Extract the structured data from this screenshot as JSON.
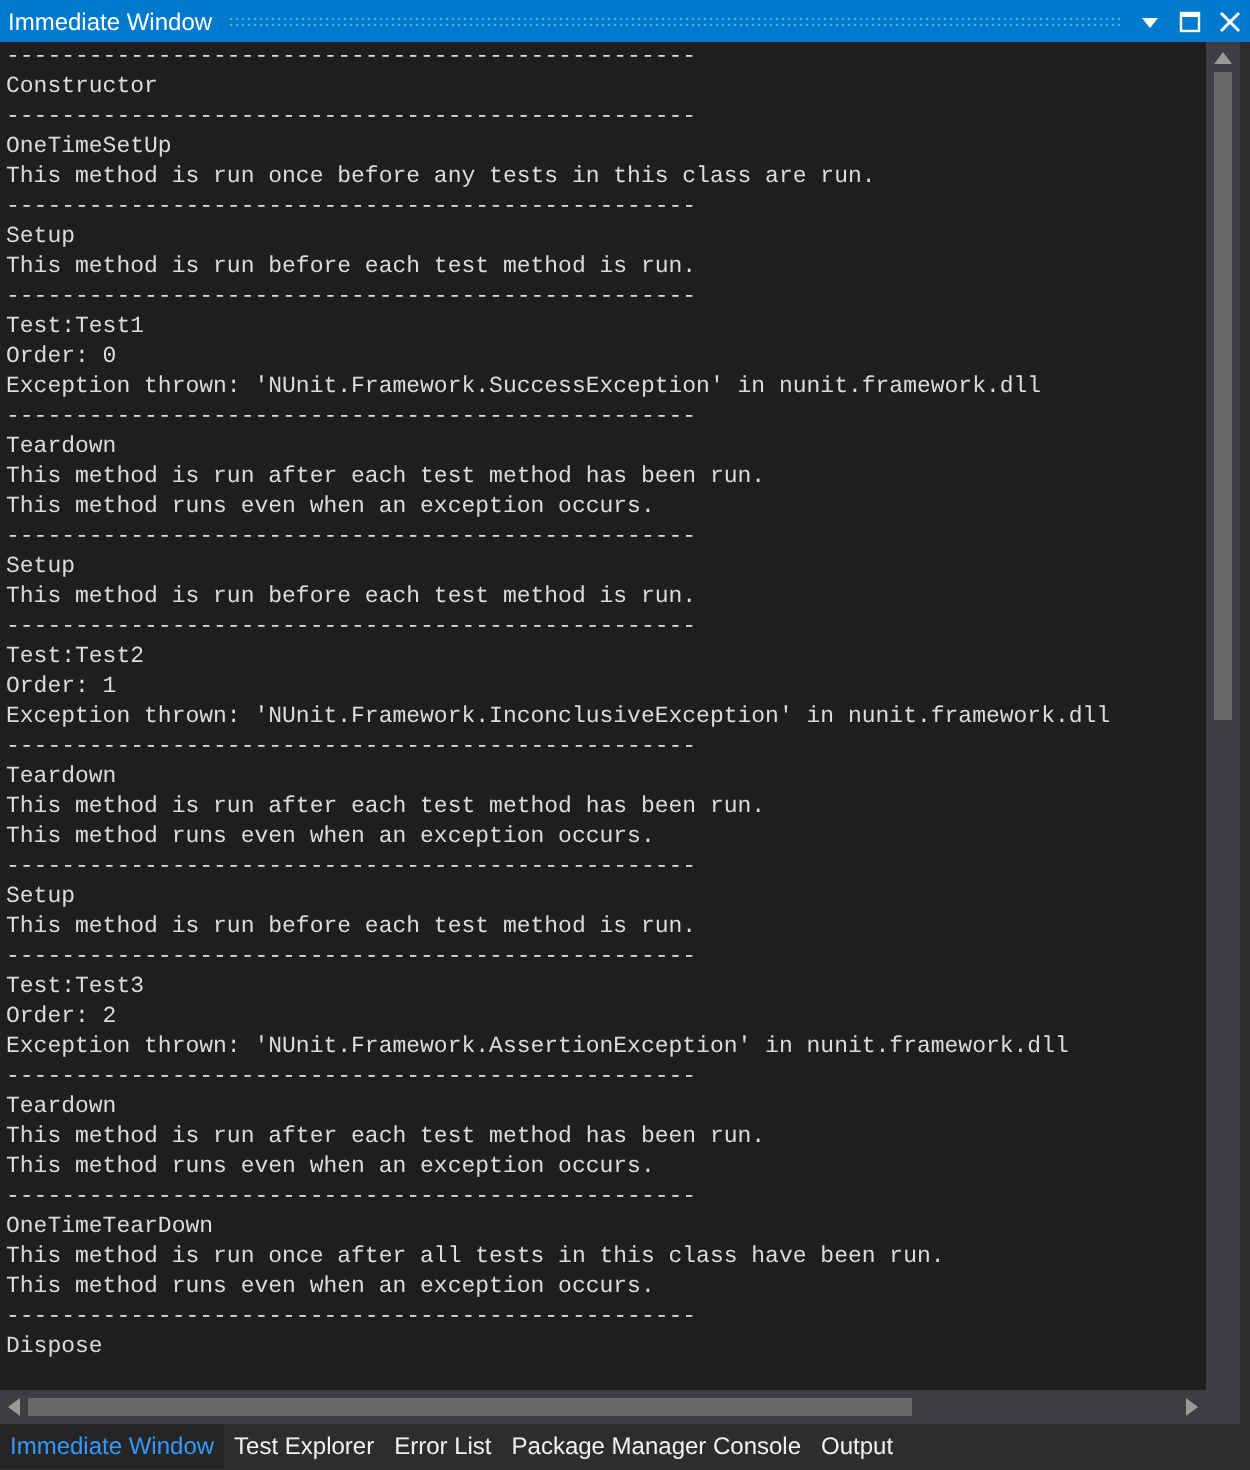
{
  "window": {
    "title": "Immediate Window"
  },
  "output": {
    "lines": [
      "--------------------------------------------------",
      "Constructor",
      "--------------------------------------------------",
      "OneTimeSetUp",
      "This method is run once before any tests in this class are run.",
      "--------------------------------------------------",
      "Setup",
      "This method is run before each test method is run.",
      "--------------------------------------------------",
      "Test:Test1",
      "Order: 0",
      "Exception thrown: 'NUnit.Framework.SuccessException' in nunit.framework.dll",
      "--------------------------------------------------",
      "Teardown",
      "This method is run after each test method has been run.",
      "This method runs even when an exception occurs.",
      "--------------------------------------------------",
      "Setup",
      "This method is run before each test method is run.",
      "--------------------------------------------------",
      "Test:Test2",
      "Order: 1",
      "Exception thrown: 'NUnit.Framework.InconclusiveException' in nunit.framework.dll",
      "--------------------------------------------------",
      "Teardown",
      "This method is run after each test method has been run.",
      "This method runs even when an exception occurs.",
      "--------------------------------------------------",
      "Setup",
      "This method is run before each test method is run.",
      "--------------------------------------------------",
      "Test:Test3",
      "Order: 2",
      "Exception thrown: 'NUnit.Framework.AssertionException' in nunit.framework.dll",
      "--------------------------------------------------",
      "Teardown",
      "This method is run after each test method has been run.",
      "This method runs even when an exception occurs.",
      "--------------------------------------------------",
      "OneTimeTearDown",
      "This method is run once after all tests in this class have been run.",
      "This method runs even when an exception occurs.",
      "--------------------------------------------------",
      "Dispose"
    ]
  },
  "tabs": [
    {
      "label": "Immediate Window",
      "selected": true
    },
    {
      "label": "Test Explorer",
      "selected": false
    },
    {
      "label": "Error List",
      "selected": false
    },
    {
      "label": "Package Manager Console",
      "selected": false
    },
    {
      "label": "Output",
      "selected": false
    }
  ]
}
